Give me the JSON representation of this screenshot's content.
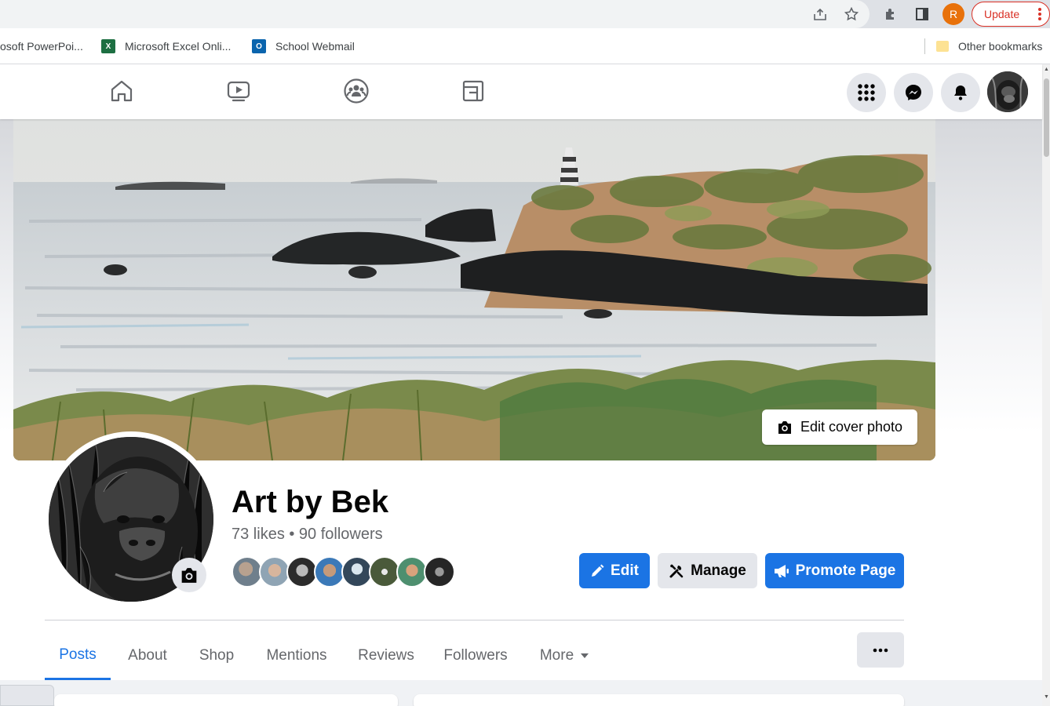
{
  "browser": {
    "profile_initial": "R",
    "update_label": "Update",
    "bookmarks": [
      {
        "label": "osoft PowerPoi...",
        "icon": "powerpoint-icon"
      },
      {
        "label": "Microsoft Excel Onli...",
        "icon": "excel-icon"
      },
      {
        "label": "School Webmail",
        "icon": "outlook-icon"
      }
    ],
    "other_bookmarks": "Other bookmarks"
  },
  "fb_nav": {
    "tabs": [
      "home-icon",
      "watch-icon",
      "groups-icon",
      "gaming-icon"
    ],
    "right_buttons": [
      "menu-grid-icon",
      "messenger-icon",
      "notifications-icon"
    ]
  },
  "page": {
    "edit_cover_label": "Edit cover photo",
    "name": "Art by Bek",
    "stats": "73 likes • 90 followers",
    "buttons": {
      "edit": "Edit",
      "manage": "Manage",
      "promote": "Promote Page"
    },
    "tabs": [
      "Posts",
      "About",
      "Shop",
      "Mentions",
      "Reviews",
      "Followers",
      "More"
    ],
    "active_tab": "Posts"
  },
  "colors": {
    "fb_blue": "#1b74e4",
    "chrome_update_red": "#d93025",
    "profile_orange": "#e8710a"
  }
}
